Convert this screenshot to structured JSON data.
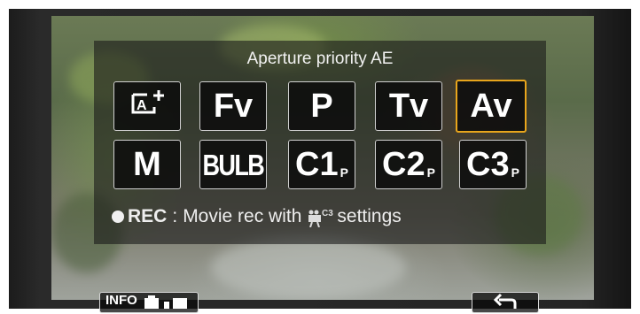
{
  "title": "Aperture priority AE",
  "modes_row1": [
    {
      "label": "",
      "icon": "scene-intelligent-auto-icon",
      "selected": false
    },
    {
      "label": "Fv",
      "selected": false
    },
    {
      "label": "P",
      "selected": false
    },
    {
      "label": "Tv",
      "selected": false
    },
    {
      "label": "Av",
      "selected": true
    }
  ],
  "modes_row2": [
    {
      "label": "M"
    },
    {
      "label": "BULB"
    },
    {
      "label": "C1",
      "sub": "P"
    },
    {
      "label": "C2",
      "sub": "P"
    },
    {
      "label": "C3",
      "sub": "P"
    }
  ],
  "rec_hint": {
    "rec": "REC",
    "colon": ":",
    "text_before": "Movie rec with",
    "icon": "movie-mode-c3-icon",
    "text_after": "settings"
  },
  "bottom": {
    "info_label": "INFO",
    "info_icon": "camera-icon",
    "back_icon": "return-arrow-icon"
  },
  "colors": {
    "selection": "#e8a51c"
  }
}
